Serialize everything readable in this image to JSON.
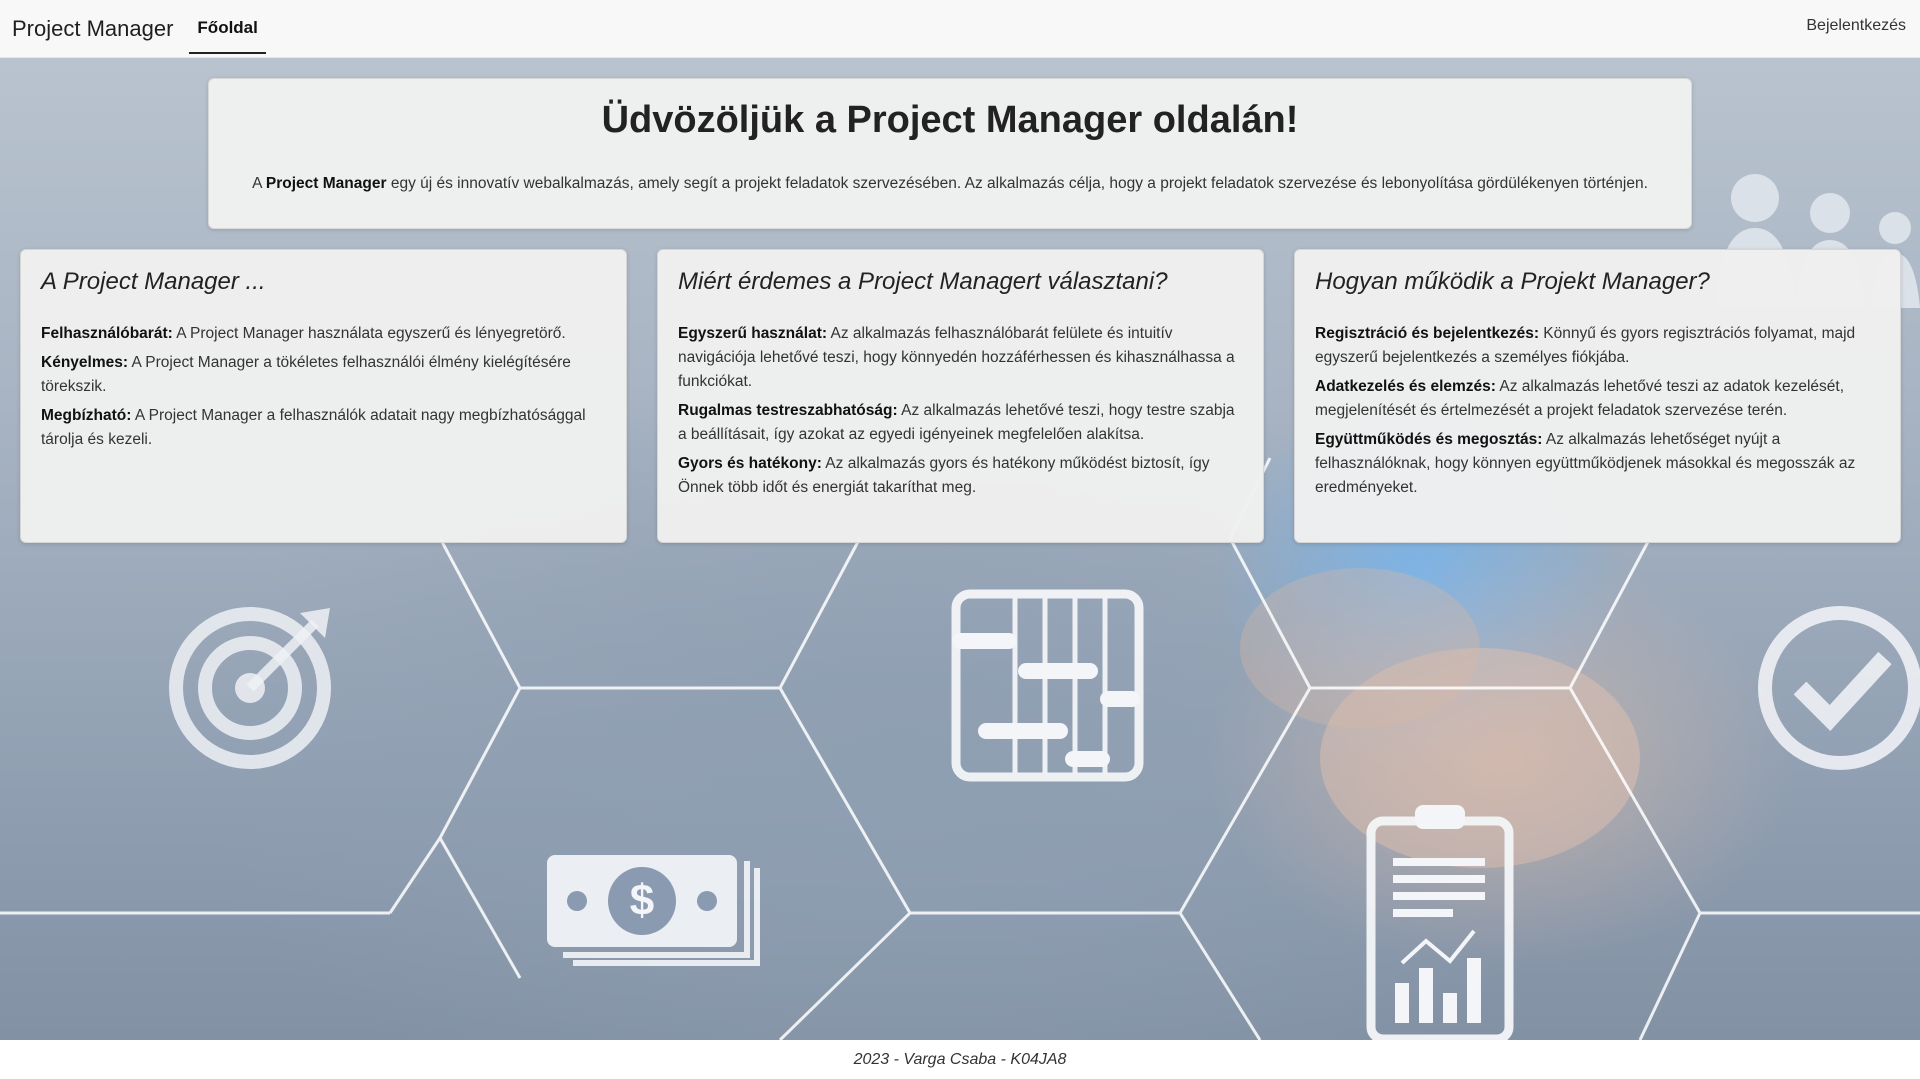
{
  "navbar": {
    "brand": "Project Manager",
    "home_link": "Főoldal",
    "login_link": "Bejelentkezés"
  },
  "welcome": {
    "title": "Üdvözöljük a Project Manager oldalán!",
    "text_prefix": "A ",
    "text_bold": "Project Manager",
    "text_rest": " egy új és innovatív webalkalmazás, amely segít a projekt feladatok szervezésében. Az alkalmazás célja, hogy a projekt feladatok szervezése és lebonyolítása gördülékenyen történjen."
  },
  "cards": [
    {
      "title": "A Project Manager ...",
      "items": [
        {
          "label": "Felhasználóbarát:",
          "text": " A Project Manager használata egyszerű és lényegretörő."
        },
        {
          "label": "Kényelmes:",
          "text": " A Project Manager a tökéletes felhasználói élmény kielégítésére törekszik."
        },
        {
          "label": "Megbízható:",
          "text": " A Project Manager a felhasználók adatait nagy megbízhatósággal tárolja és kezeli."
        }
      ]
    },
    {
      "title": "Miért érdemes a Project Managert választani?",
      "items": [
        {
          "label": "Egyszerű használat:",
          "text": " Az alkalmazás felhasználóbarát felülete és intuitív navigációja lehetővé teszi, hogy könnyedén hozzáférhessen és kihasználhassa a funkciókat."
        },
        {
          "label": "Rugalmas testreszabhatóság:",
          "text": " Az alkalmazás lehetővé teszi, hogy testre szabja a beállításait, így azokat az egyedi igényeinek megfelelően alakítsa."
        },
        {
          "label": "Gyors és hatékony:",
          "text": " Az alkalmazás gyors és hatékony működést biztosít, így Önnek több időt és energiát takaríthat meg."
        }
      ]
    },
    {
      "title": "Hogyan működik a Projekt Manager?",
      "items": [
        {
          "label": "Regisztráció és bejelentkezés:",
          "text": " Könnyű és gyors regisztrációs folyamat, majd egyszerű bejelentkezés a személyes fiókjába."
        },
        {
          "label": "Adatkezelés és elemzés:",
          "text": " Az alkalmazás lehetővé teszi az adatok kezelését, megjelenítését és értelmezését a projekt feladatok szervezése terén."
        },
        {
          "label": "Együttműködés és megosztás:",
          "text": " Az alkalmazás lehetőséget nyújt a felhasználóknak, hogy könnyen együttműködjenek másokkal és megosszák az eredményeket."
        }
      ]
    }
  ],
  "background_icons": [
    "target-icon",
    "dollar-bill-icon",
    "gantt-chart-icon",
    "clipboard-chart-icon",
    "checkmark-icon",
    "people-icon"
  ],
  "footer": {
    "text": "2023 - Varga Csaba - K04JA8"
  }
}
